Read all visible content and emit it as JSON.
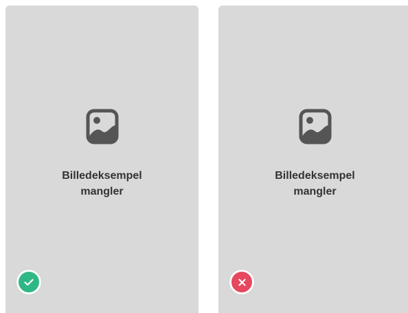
{
  "colors": {
    "card_background": "#d9d9d9",
    "icon": "#555555",
    "caption_text": "#333333",
    "ok_badge": "#2fb886",
    "error_badge": "#e5485f"
  },
  "cards": [
    {
      "icon": "image-placeholder-icon",
      "caption": "Billedeksempel\nmangler",
      "status": "check-icon"
    },
    {
      "icon": "image-placeholder-icon",
      "caption": "Billedeksempel\nmangler",
      "status": "close-icon"
    }
  ]
}
